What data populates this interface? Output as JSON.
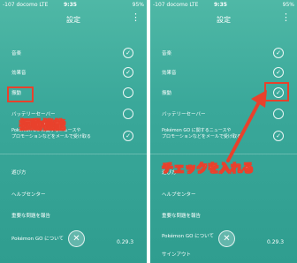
{
  "status": {
    "carrier": "-107 docomo  LTE",
    "time": "9:35",
    "battery": "95%"
  },
  "title": "設定",
  "left": {
    "rows": [
      "音楽",
      "効果音",
      "振動",
      "バッテリーセーバー"
    ],
    "desc_line1": "Pokémon GO に関するニュースや",
    "desc_line2": "プロモーションなどをメールで受け取る",
    "links": [
      "遊び方",
      "ヘルプセンター",
      "重要な問題を報告",
      "Pokémon GO について"
    ]
  },
  "right": {
    "rows": [
      "音楽",
      "効果音",
      "振動",
      "バッテリーセーバー"
    ],
    "desc_line1": "Pokémon GO に関するニュースや",
    "desc_line2": "プロモーションなどをメールで受け取る",
    "links": [
      "遊び方",
      "ヘルプセンター",
      "重要な問題を報告",
      "Pokémon GO について",
      "サインアウト"
    ]
  },
  "version": "0.29.3",
  "annotations": {
    "a1": "振動機能",
    "a2": "チェックを入れる"
  },
  "colors": {
    "accent": "#e8412c",
    "bg": "#3aa89a"
  }
}
